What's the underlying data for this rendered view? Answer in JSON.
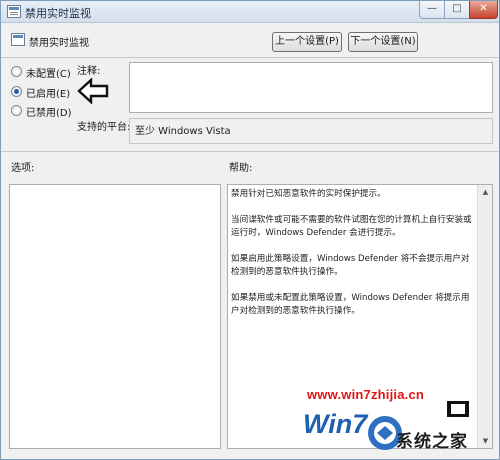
{
  "window": {
    "title": "禁用实时监视",
    "controls": {
      "minimize": "—",
      "maximize": "□",
      "close": "✕"
    }
  },
  "header": {
    "policy_name": "禁用实时监视",
    "prev_button": "上一个设置(P)",
    "next_button": "下一个设置(N)"
  },
  "state_options": [
    {
      "label": "未配置(C)",
      "selected": false
    },
    {
      "label": "已启用(E)",
      "selected": true
    },
    {
      "label": "已禁用(D)",
      "selected": false
    }
  ],
  "comment": {
    "label": "注释:",
    "value": ""
  },
  "platform": {
    "label": "支持的平台:",
    "value": "至少 Windows Vista"
  },
  "options": {
    "label": "选项:"
  },
  "help": {
    "label": "帮助:",
    "paragraphs": [
      "禁用针对已知恶意软件的实时保护提示。",
      "当间谍软件或可能不需要的软件试图在您的计算机上自行安装或运行时，Windows Defender 会进行提示。",
      "如果启用此策略设置，Windows Defender 将不会提示用户对检测到的恶意软件执行操作。",
      "如果禁用或未配置此策略设置，Windows Defender 将提示用户对检测到的恶意软件执行操作。"
    ]
  },
  "watermark": {
    "url": "www.win7zhijia.cn",
    "logo_text": "Win7",
    "brand": "系统之家",
    "sub": "www.win7zhijia.cn",
    "colors": {
      "url": "#e01515",
      "logo": "#1f5fb0"
    }
  },
  "icons": [
    "policy-icon",
    "arrow-left-icon",
    "scroll-up-icon",
    "scroll-down-icon"
  ]
}
